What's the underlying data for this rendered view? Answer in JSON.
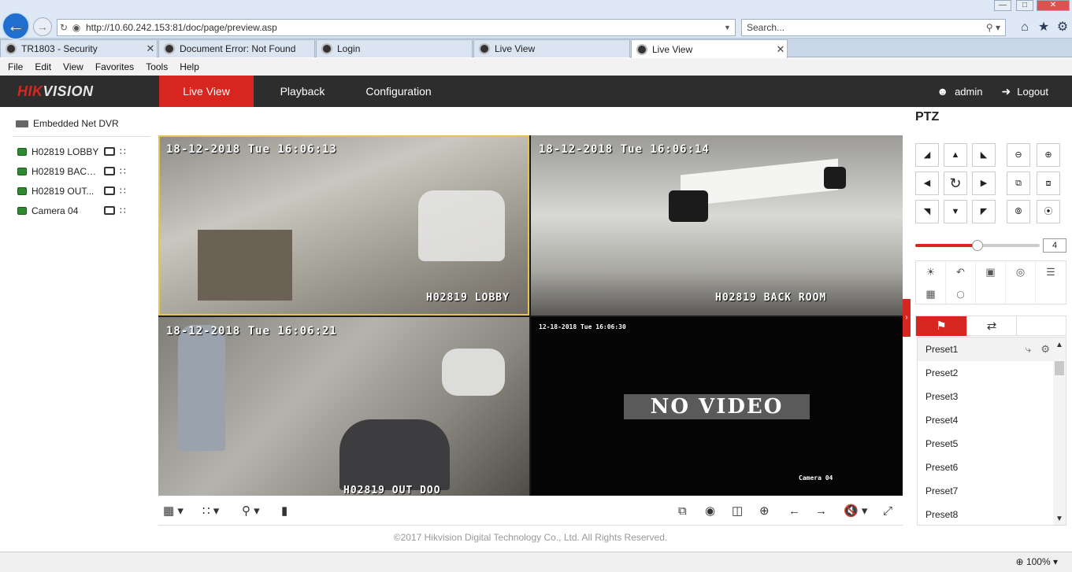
{
  "browser": {
    "url": "http://10.60.242.153:81/doc/page/preview.asp",
    "search_placeholder": "Search...",
    "tabs": [
      {
        "title": "TR1803 - Security",
        "closable": true
      },
      {
        "title": "Document Error: Not Found",
        "closable": false
      },
      {
        "title": "Login",
        "closable": false
      },
      {
        "title": "Live View",
        "closable": false
      },
      {
        "title": "Live View",
        "closable": true,
        "active": true
      }
    ],
    "menu": [
      "File",
      "Edit",
      "View",
      "Favorites",
      "Tools",
      "Help"
    ],
    "zoom": "100%"
  },
  "app": {
    "logo_hik": "HIK",
    "logo_vision": "VISION",
    "nav": [
      "Live View",
      "Playback",
      "Configuration"
    ],
    "active_nav": "Live View",
    "user": "admin",
    "logout": "Logout",
    "accent": "#d7251f"
  },
  "tree": {
    "root": "Embedded Net DVR",
    "cameras": [
      "H02819 LOBBY",
      "H02819 BACK...",
      "H02819 OUT...",
      "Camera 04"
    ]
  },
  "video": {
    "tiles": [
      {
        "time": "18-12-2018 Tue 16:06:13",
        "name": "H02819 LOBBY"
      },
      {
        "time": "18-12-2018 Tue 16:06:14",
        "name": "H02819 BACK ROOM"
      },
      {
        "time": "18-12-2018 Tue 16:06:21",
        "name": "H02819 OUT DOO"
      },
      {
        "time": "12-18-2018 Tue 16:06:30",
        "name": "Camera 04",
        "no_video": "NO VIDEO"
      }
    ]
  },
  "footer": "©2017 Hikvision Digital Technology Co., Ltd. All Rights Reserved.",
  "ptz": {
    "title": "PTZ",
    "speed": "4",
    "presets": [
      "Preset1",
      "Preset2",
      "Preset3",
      "Preset4",
      "Preset5",
      "Preset6",
      "Preset7",
      "Preset8"
    ]
  }
}
